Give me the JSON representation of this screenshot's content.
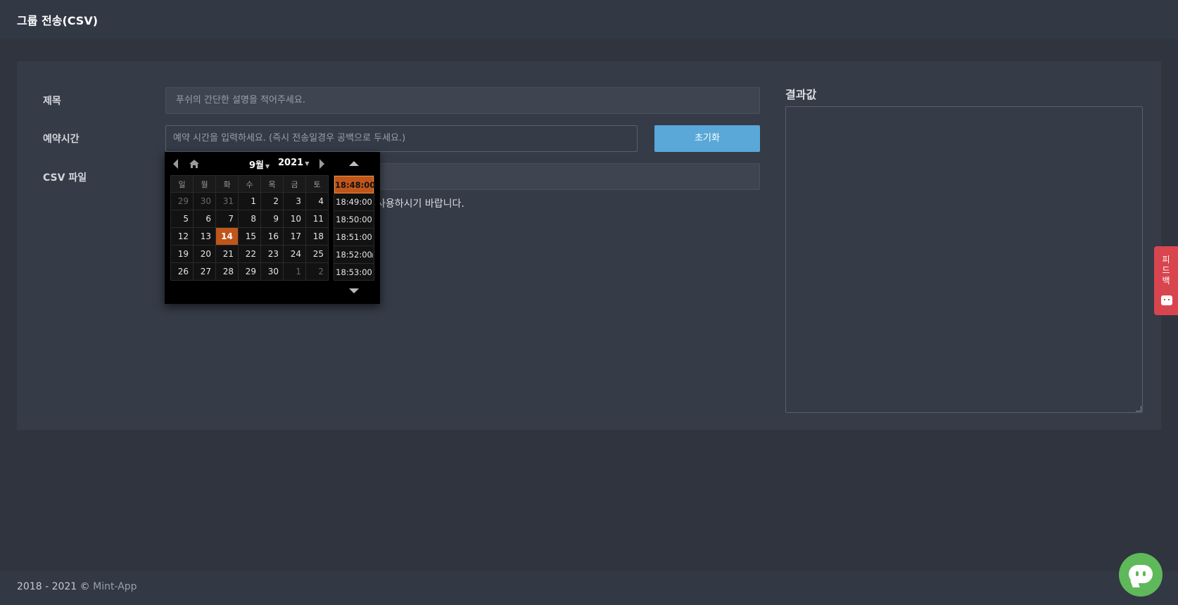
{
  "header": {
    "title": "그룹 전송(CSV)"
  },
  "form": {
    "title_label": "제목",
    "title_placeholder": "푸쉬의 간단한 설명을 적어주세요.",
    "schedule_label": "예약시간",
    "schedule_placeholder": "예약 시간을  입력하세요. (즉시 전송일경우 공백으로 두세요.)",
    "reset_button": "초기화",
    "csv_label": "CSV 파일",
    "csv_help_visible": "사용하시기 바랍니다."
  },
  "result": {
    "label": "결과값"
  },
  "datepicker": {
    "month": "9월",
    "year": "2021",
    "weekdays": [
      "일",
      "월",
      "화",
      "수",
      "목",
      "금",
      "토"
    ],
    "weeks": [
      [
        {
          "d": "29",
          "o": true
        },
        {
          "d": "30",
          "o": true
        },
        {
          "d": "31",
          "o": true
        },
        {
          "d": "1"
        },
        {
          "d": "2"
        },
        {
          "d": "3"
        },
        {
          "d": "4"
        }
      ],
      [
        {
          "d": "5"
        },
        {
          "d": "6"
        },
        {
          "d": "7"
        },
        {
          "d": "8"
        },
        {
          "d": "9"
        },
        {
          "d": "10"
        },
        {
          "d": "11"
        }
      ],
      [
        {
          "d": "12"
        },
        {
          "d": "13"
        },
        {
          "d": "14",
          "t": true
        },
        {
          "d": "15"
        },
        {
          "d": "16"
        },
        {
          "d": "17"
        },
        {
          "d": "18"
        }
      ],
      [
        {
          "d": "19"
        },
        {
          "d": "20"
        },
        {
          "d": "21"
        },
        {
          "d": "22"
        },
        {
          "d": "23"
        },
        {
          "d": "24"
        },
        {
          "d": "25"
        }
      ],
      [
        {
          "d": "26"
        },
        {
          "d": "27"
        },
        {
          "d": "28"
        },
        {
          "d": "29"
        },
        {
          "d": "30"
        },
        {
          "d": "1",
          "o": true
        },
        {
          "d": "2",
          "o": true
        }
      ]
    ],
    "times": [
      "18:48:00",
      "18:49:00",
      "18:50:00",
      "18:51:00",
      "18:52:00",
      "18:53:00"
    ],
    "selected_time": "18:48:00"
  },
  "feedback": {
    "label": "피드백"
  },
  "footer": {
    "copyright": "2018 - 2021 © ",
    "brand": "Mint-App"
  }
}
